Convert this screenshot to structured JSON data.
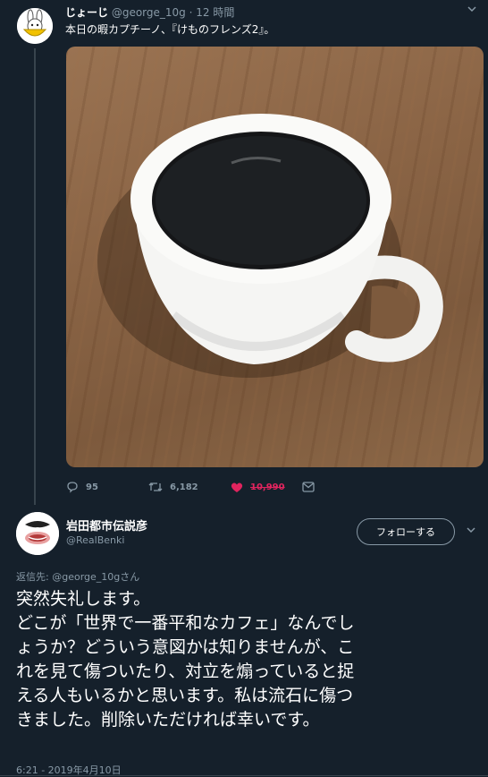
{
  "tweet1": {
    "name": "じょーじ",
    "handle": "@george_10g",
    "separator": "·",
    "time": "12 時間",
    "text": "本日の暇カプチーノ、『けものフレンズ2』。",
    "replies": "95",
    "retweets": "6,182",
    "likes": "10,990"
  },
  "tweet2": {
    "name": "岩田都市伝説彦",
    "handle": "@RealBenki",
    "follow_label": "フォローする",
    "reply_prefix": "返信先:",
    "reply_mention": "@george_10g",
    "reply_suffix": "さん",
    "lines": [
      "突然失礼します。",
      "どこが「世界で一番平和なカフェ」なんでし",
      "ょうか？どういう意図かは知りませんが、こ",
      "れを見て傷ついたり、対立を煽っていると捉",
      "える人もいるかと思います。私は流石に傷つ",
      "きました。削除いただければ幸いです。"
    ],
    "timestamp": "6:21 - 2019年4月10日"
  },
  "colors": {
    "background": "#15202b",
    "secondary_text": "#8899a6",
    "like_red": "#e0245e",
    "divider": "#38444d"
  },
  "icons": [
    "reply-icon",
    "retweet-icon",
    "heart-icon",
    "message-icon",
    "chevron-down-icon"
  ]
}
